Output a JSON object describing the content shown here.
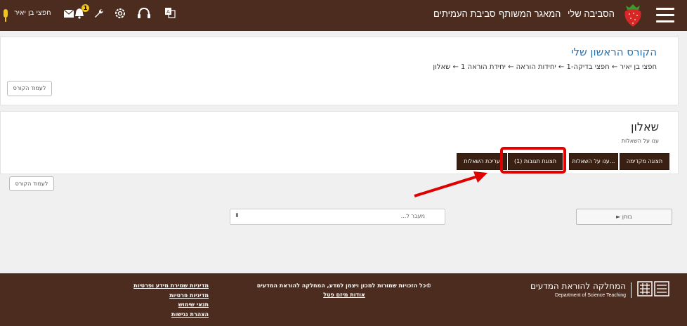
{
  "navbar": {
    "my_home": "הסביבה שלי",
    "shared_repo": "המאגר המשותף",
    "peer_space": "סביבת העמיתים",
    "user_name": "חפצי בן יאיר",
    "notification_count": "1",
    "icons": [
      "hamburger-icon",
      "strawberry-logo",
      "translate-icon",
      "headset-icon",
      "gear-icon",
      "wrench-icon",
      "bell-icon",
      "envelope-icon",
      "user-avatar"
    ]
  },
  "course": {
    "title": "הקורס הראשון שלי",
    "breadcrumb": "חפצי בן יאיר ← חפצי בדיקה-1 ← יחידות הוראה ← יחידת הוראה 1 ← שאלון",
    "course_page_button": "לעמוד הקורס"
  },
  "quiz": {
    "title": "שאלון",
    "subtitle": "ענו על השאלות",
    "buttons": {
      "preview": "תצוגה מקדימה",
      "answer": "ענו על השאלות...",
      "responses": "תצוגת תגובות (1)",
      "edit": "עריכת השאלות"
    },
    "course_page_button": "לעמוד הקורס"
  },
  "navigation": {
    "jump_placeholder": "מעבר ל...",
    "next_button": "► בוחן"
  },
  "footer": {
    "links": [
      "מדיניות שמירת מידע ופרטיות",
      "מדיניות פרטיות",
      "תנאי שימוש",
      "הצהרת נגישות"
    ],
    "copyright": "©כל הזכויות שמורות למכון ויצמן למדע, המחלקה להוראת המדעים",
    "about": "אודות מיזם פטל",
    "dept_he": "המחלקה להוראת המדעים",
    "dept_en": "Department of Science Teaching"
  },
  "colors": {
    "navbar": "#4b2c1e",
    "dark_button": "#3a1f13",
    "link_blue": "#2a6fa8",
    "highlight_red": "#e00000"
  }
}
